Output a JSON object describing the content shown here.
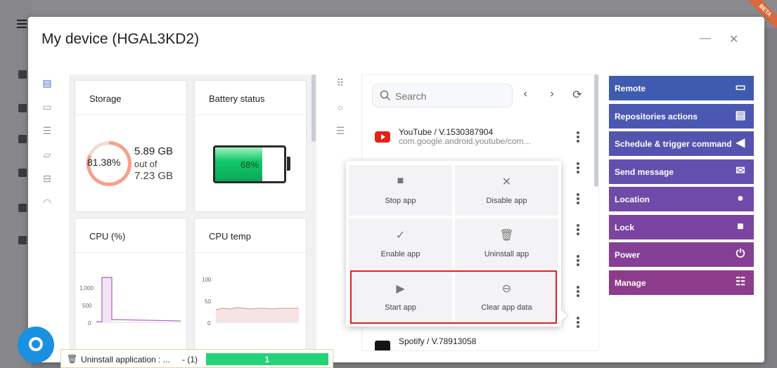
{
  "dialog": {
    "title": "My device (HGAL3KD2)"
  },
  "widgets": {
    "storage": {
      "title": "Storage",
      "percent": "81.38%",
      "used": "5.89 GB",
      "out_of": "out of",
      "total": "7.23 GB",
      "fraction": 0.8138
    },
    "battery": {
      "title": "Battery status",
      "percent": "68%",
      "level": 0.68
    },
    "cpu": {
      "title": "CPU (%)",
      "y_ticks": [
        "1,000",
        "500",
        "0"
      ]
    },
    "cpu_temp": {
      "title": "CPU temp",
      "y_ticks": [
        "100",
        "50",
        "0"
      ]
    }
  },
  "applist": {
    "search_placeholder": "Search",
    "apps": [
      {
        "name": "YouTube / V.1530387904",
        "package": "com.google.android.youtube/com...",
        "icon": "youtube-icon"
      },
      {
        "name": "Spotify / V.78913058",
        "package": "",
        "icon": "spotify-icon"
      }
    ]
  },
  "context_menu": {
    "items": [
      {
        "label": "Stop app",
        "icon": "stop-icon"
      },
      {
        "label": "Disable app",
        "icon": "close-icon"
      },
      {
        "label": "Enable app",
        "icon": "check-icon"
      },
      {
        "label": "Uninstall app",
        "icon": "trash-icon"
      },
      {
        "label": "Start app",
        "icon": "play-icon"
      },
      {
        "label": "Clear app data",
        "icon": "minus-circle-icon"
      }
    ]
  },
  "actions": [
    {
      "label": "Remote",
      "icon": "monitor-icon",
      "color": "#3f5bb0"
    },
    {
      "label": "Repositories actions",
      "icon": "clipboard-icon",
      "color": "#4b58b3"
    },
    {
      "label": "Schedule & trigger command",
      "icon": "megaphone-icon",
      "color": "#5453b0"
    },
    {
      "label": "Send message",
      "icon": "envelope-icon",
      "color": "#6250ae"
    },
    {
      "label": "Location",
      "icon": "pin-icon",
      "color": "#6f4aa8"
    },
    {
      "label": "Lock",
      "icon": "lock-icon",
      "color": "#7b44a0"
    },
    {
      "label": "Power",
      "icon": "power-icon",
      "color": "#853f96"
    },
    {
      "label": "Manage",
      "icon": "checklist-icon",
      "color": "#8c3c8a"
    }
  ],
  "task": {
    "label": "Uninstall application : ...",
    "count": "- (1)",
    "progress_value": "1",
    "progress": 1.0
  },
  "badge": "BETA",
  "colors": {
    "accent": "#4a6ec0",
    "progress": "#22d378",
    "battery": "#11c96a",
    "highlight": "#e02020"
  }
}
